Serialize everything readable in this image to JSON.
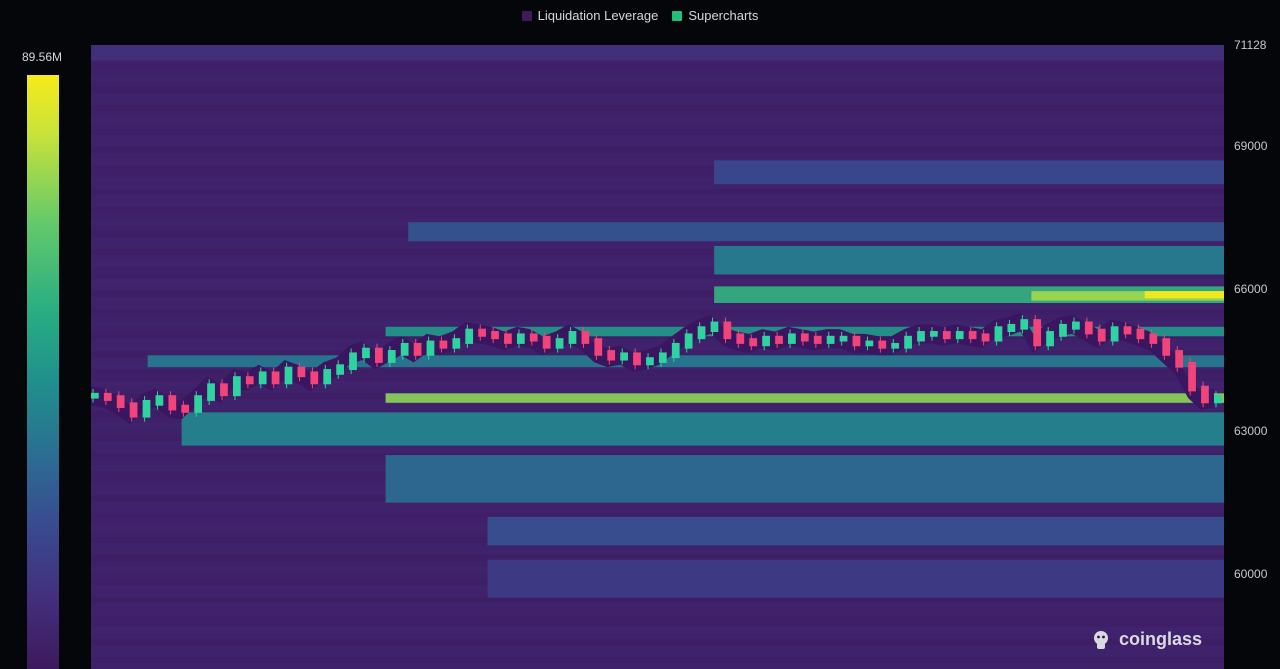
{
  "legend": {
    "items": [
      {
        "label": "Liquidation Leverage",
        "color": "#3d1a5c"
      },
      {
        "label": "Supercharts",
        "color": "#23c07a"
      }
    ]
  },
  "colorbar": {
    "max_label": "89.56M"
  },
  "watermark": {
    "text": "coinglass"
  },
  "chart_data": {
    "type": "heatmap",
    "title": "",
    "xlabel": "",
    "ylabel": "",
    "colorbar_max": 89560000,
    "ylim": [
      58000,
      71128
    ],
    "yticks": [
      {
        "value": 71128,
        "label": "71128"
      },
      {
        "value": 69000,
        "label": "69000"
      },
      {
        "value": 66000,
        "label": "66000"
      },
      {
        "value": 63000,
        "label": "63000"
      },
      {
        "value": 60000,
        "label": "60000"
      }
    ],
    "bands": [
      {
        "price_from": 70800,
        "price_to": 71128,
        "x_start": 0,
        "intensity": 0.16
      },
      {
        "price_from": 68200,
        "price_to": 68700,
        "x_start": 0.55,
        "intensity": 0.3
      },
      {
        "price_from": 67000,
        "price_to": 67400,
        "x_start": 0.28,
        "intensity": 0.35
      },
      {
        "price_from": 66300,
        "price_to": 66900,
        "x_start": 0.55,
        "intensity": 0.52
      },
      {
        "price_from": 65700,
        "price_to": 66050,
        "x_start": 0.55,
        "intensity": 0.72
      },
      {
        "price_from": 65750,
        "price_to": 65950,
        "x_start": 0.83,
        "intensity": 0.88
      },
      {
        "price_from": 65800,
        "price_to": 65950,
        "x_start": 0.93,
        "intensity": 1.0
      },
      {
        "price_from": 65000,
        "price_to": 65200,
        "x_start": 0.26,
        "intensity": 0.62
      },
      {
        "price_from": 64350,
        "price_to": 64600,
        "x_start": 0.05,
        "intensity": 0.5
      },
      {
        "price_from": 63600,
        "price_to": 63800,
        "x_start": 0.26,
        "intensity": 0.86
      },
      {
        "price_from": 62700,
        "price_to": 63400,
        "x_start": 0.08,
        "intensity": 0.55
      },
      {
        "price_from": 61500,
        "price_to": 62500,
        "x_start": 0.26,
        "intensity": 0.45
      },
      {
        "price_from": 60600,
        "price_to": 61200,
        "x_start": 0.35,
        "intensity": 0.33
      },
      {
        "price_from": 59500,
        "price_to": 60300,
        "x_start": 0.35,
        "intensity": 0.22
      }
    ],
    "price_series": [
      63750,
      63700,
      63550,
      63350,
      63600,
      63700,
      63500,
      63450,
      63700,
      63950,
      63800,
      64100,
      64050,
      64200,
      64050,
      64300,
      64200,
      64050,
      64250,
      64350,
      64600,
      64700,
      64500,
      64650,
      64800,
      64650,
      64850,
      64800,
      64900,
      65100,
      65050,
      65000,
      64900,
      65000,
      64950,
      64800,
      64900,
      65050,
      64900,
      64650,
      64550,
      64600,
      64450,
      64500,
      64600,
      64800,
      65000,
      65150,
      65250,
      65000,
      64900,
      64850,
      64950,
      64900,
      65000,
      64950,
      64900,
      64950,
      64950,
      64850,
      64850,
      64800,
      64800,
      64950,
      65050,
      65050,
      65000,
      65050,
      65000,
      64950,
      65150,
      65200,
      65300,
      64850,
      65050,
      65200,
      65250,
      65100,
      64950,
      65150,
      65100,
      65000,
      64900,
      64650,
      64400,
      63900,
      63650,
      63700
    ]
  }
}
